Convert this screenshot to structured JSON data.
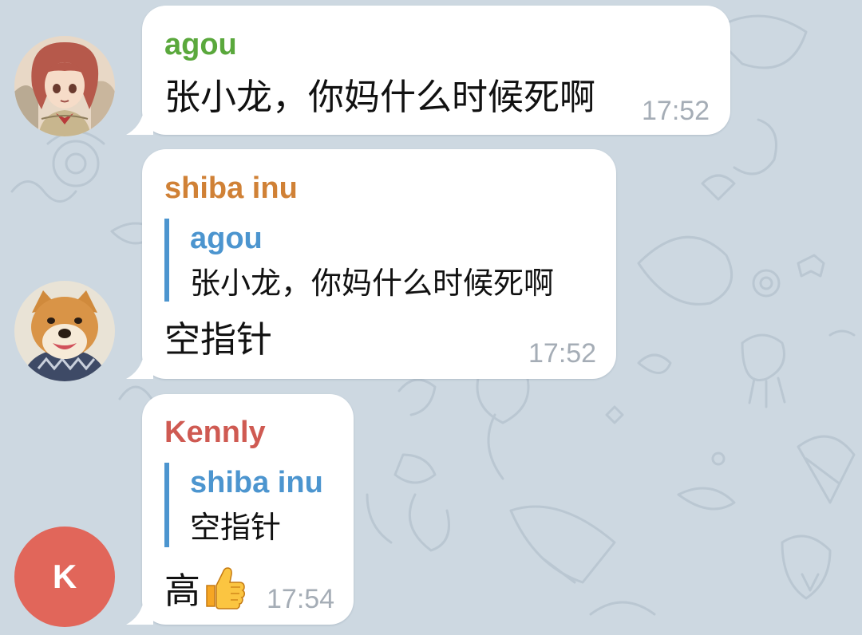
{
  "colors": {
    "background": "#cdd8e1",
    "bubble": "#ffffff",
    "reply_accent": "#4c95cf",
    "time": "#a5adb6"
  },
  "messages": [
    {
      "sender": "agou",
      "sender_color": "#5aa83c",
      "avatar": "anime-girl-avatar",
      "text": "张小龙，你妈什么时候死啊",
      "time": "17:52"
    },
    {
      "sender": "shiba inu",
      "sender_color": "#d08136",
      "avatar": "shiba-dog-avatar",
      "reply": {
        "name": "agou",
        "text": "张小龙，你妈什么时候死啊"
      },
      "text": "空指针",
      "time": "17:52"
    },
    {
      "sender": "Kennly",
      "sender_color": "#cf5a52",
      "avatar": "letter-avatar",
      "avatar_letter": "K",
      "avatar_color": "#e1665a",
      "reply": {
        "name": "shiba inu",
        "text": "空指针"
      },
      "text": "高",
      "emoji": "thumbs-up-icon",
      "time": "17:54"
    }
  ]
}
